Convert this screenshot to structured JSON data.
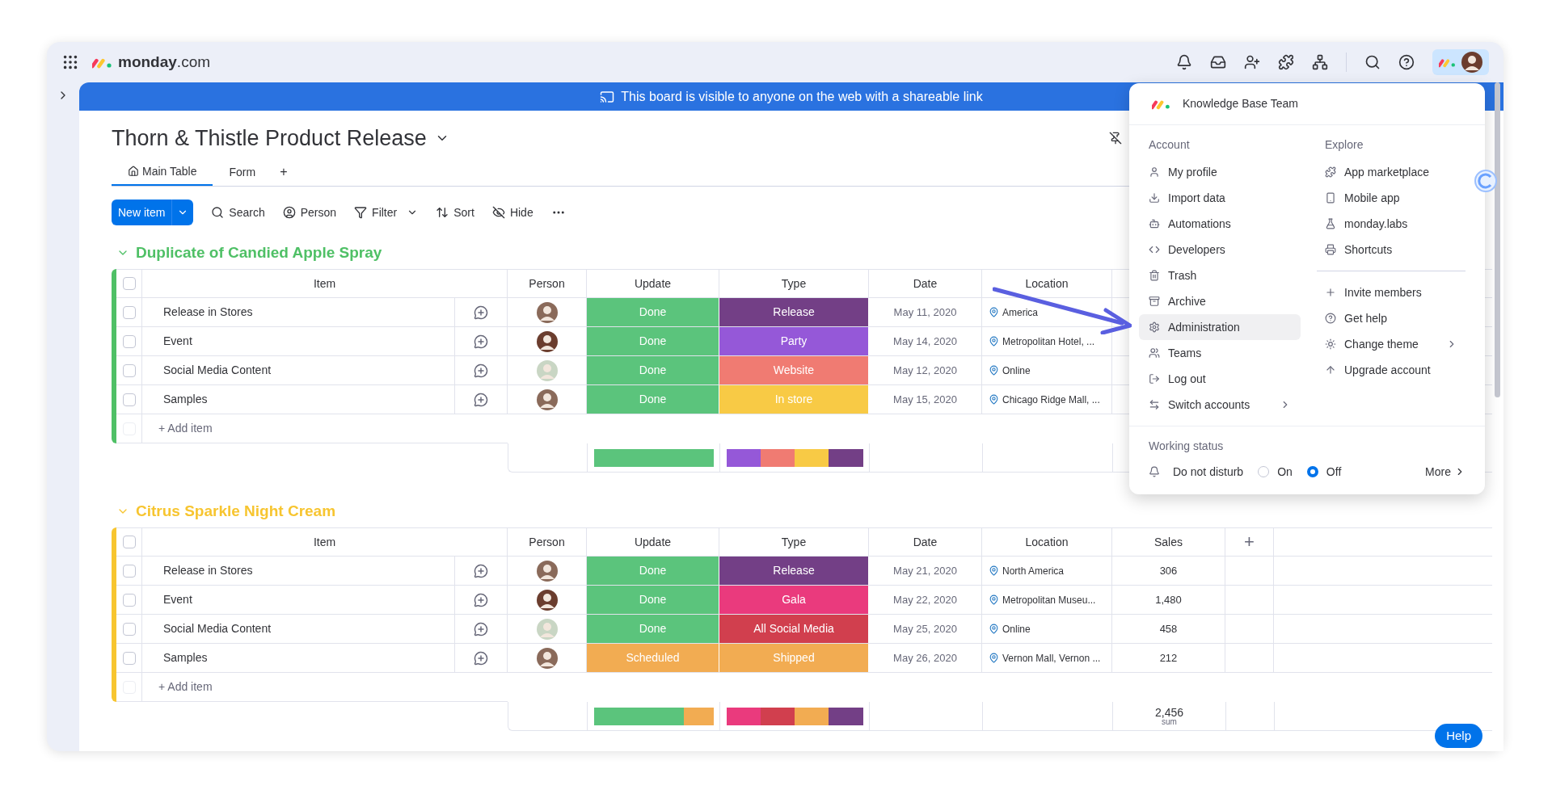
{
  "brand": "**monday**.com",
  "banner": {
    "text": "This board is visible to anyone on the web with a shareable link"
  },
  "board": {
    "title": "Thorn & Thistle Product Release",
    "tabs": [
      {
        "label": "Main Table",
        "selected": true
      },
      {
        "label": "Form",
        "selected": false
      }
    ],
    "add_tab": "+"
  },
  "toolbar": {
    "new_item": "New item",
    "actions": [
      {
        "label": "Search",
        "dropdown": false
      },
      {
        "label": "Person",
        "dropdown": false
      },
      {
        "label": "Filter",
        "dropdown": true
      },
      {
        "label": "Sort",
        "dropdown": false
      },
      {
        "label": "Hide",
        "dropdown": false
      }
    ]
  },
  "groups": [
    {
      "name": "Duplicate of Candied Apple Spray",
      "color": "#4fc066",
      "columns": [
        {
          "label": "Item",
          "kind": "item"
        },
        {
          "label": "Person",
          "kind": "person"
        },
        {
          "label": "Update",
          "kind": "update"
        },
        {
          "label": "Type",
          "kind": "type"
        },
        {
          "label": "Date",
          "kind": "date"
        },
        {
          "label": "Location",
          "kind": "location"
        }
      ],
      "rows": [
        {
          "item": "Release in Stores",
          "checked": false,
          "update": {
            "label": "Done",
            "color": "#5bc47c"
          },
          "type": {
            "label": "Release",
            "color": "#733f86"
          },
          "date": "May 11, 2020",
          "location": "America"
        },
        {
          "item": "Event",
          "checked": false,
          "update": {
            "label": "Done",
            "color": "#5bc47c"
          },
          "type": {
            "label": "Party",
            "color": "#9558d8"
          },
          "date": "May 14, 2020",
          "location": "Metropolitan Hotel, ..."
        },
        {
          "item": "Social Media Content",
          "checked": false,
          "update": {
            "label": "Done",
            "color": "#5bc47c"
          },
          "type": {
            "label": "Website",
            "color": "#f07b72"
          },
          "date": "May 12, 2020",
          "location": "Online"
        },
        {
          "item": "Samples",
          "checked": false,
          "update": {
            "label": "Done",
            "color": "#5bc47c"
          },
          "type": {
            "label": "In store",
            "color": "#f8ca45"
          },
          "date": "May 15, 2020",
          "location": "Chicago Ridge Mall, ..."
        }
      ],
      "add_item": "+ Add item",
      "summary": {
        "update": [
          {
            "color": "#5bc47c"
          },
          {
            "color": "#5bc47c"
          },
          {
            "color": "#5bc47c"
          },
          {
            "color": "#5bc47c"
          }
        ],
        "type": [
          {
            "color": "#9558d8"
          },
          {
            "color": "#f07b72"
          },
          {
            "color": "#f8ca45"
          },
          {
            "color": "#733f86"
          }
        ]
      },
      "all_checked": false,
      "add_item_checkbox_disabled": true
    },
    {
      "name": "Citrus Sparkle Night Cream",
      "color": "#f7c530",
      "add_column": "+",
      "columns": [
        {
          "label": "Item",
          "kind": "item"
        },
        {
          "label": "Person",
          "kind": "person"
        },
        {
          "label": "Update",
          "kind": "update"
        },
        {
          "label": "Type",
          "kind": "type"
        },
        {
          "label": "Date",
          "kind": "date"
        },
        {
          "label": "Location",
          "kind": "location"
        },
        {
          "label": "Sales",
          "kind": "sales"
        }
      ],
      "rows": [
        {
          "item": "Release in Stores",
          "checked": false,
          "update": {
            "label": "Done",
            "color": "#5bc47c"
          },
          "type": {
            "label": "Release",
            "color": "#733f86"
          },
          "date": "May 21, 2020",
          "location": "North America",
          "sales": "306"
        },
        {
          "item": "Event",
          "checked": false,
          "update": {
            "label": "Done",
            "color": "#5bc47c"
          },
          "type": {
            "label": "Gala",
            "color": "#ea3a7d"
          },
          "date": "May 22, 2020",
          "location": "Metropolitan Museu...",
          "sales": "1,480"
        },
        {
          "item": "Social Media Content",
          "checked": false,
          "update": {
            "label": "Done",
            "color": "#5bc47c"
          },
          "type": {
            "label": "All Social Media",
            "color": "#d13f4e"
          },
          "date": "May 25, 2020",
          "location": "Online",
          "sales": "458"
        },
        {
          "item": "Samples",
          "checked": false,
          "update": {
            "label": "Scheduled",
            "color": "#f2ac52"
          },
          "type": {
            "label": "Shipped",
            "color": "#f2ac52"
          },
          "date": "May 26, 2020",
          "location": "Vernon Mall, Vernon ...",
          "sales": "212"
        }
      ],
      "add_item": "+ Add item",
      "summary": {
        "update": [
          {
            "color": "#5bc47c"
          },
          {
            "color": "#5bc47c"
          },
          {
            "color": "#5bc47c"
          },
          {
            "color": "#f2ac52"
          }
        ],
        "type": [
          {
            "color": "#ea3a7d"
          },
          {
            "color": "#d13f4e"
          },
          {
            "color": "#f2ac52"
          },
          {
            "color": "#733f86"
          }
        ],
        "sales": {
          "value": "2,456",
          "label": "sum"
        }
      },
      "all_checked": false,
      "add_item_checkbox_disabled": true
    }
  ],
  "menu": {
    "team": "Knowledge Base Team",
    "account": {
      "heading": "Account",
      "items": [
        {
          "label": "My profile",
          "selected": false,
          "submenu": false
        },
        {
          "label": "Import data",
          "selected": false,
          "submenu": false
        },
        {
          "label": "Automations",
          "selected": false,
          "submenu": false
        },
        {
          "label": "Developers",
          "selected": false,
          "submenu": false
        },
        {
          "label": "Trash",
          "selected": false,
          "submenu": false
        },
        {
          "label": "Archive",
          "selected": false,
          "submenu": false
        },
        {
          "label": "Administration",
          "selected": true,
          "submenu": false
        },
        {
          "label": "Teams",
          "selected": false,
          "submenu": false
        },
        {
          "label": "Log out",
          "selected": false,
          "submenu": false
        },
        {
          "label": "Switch accounts",
          "selected": false,
          "submenu": true
        }
      ]
    },
    "explore": {
      "heading": "Explore",
      "items": [
        {
          "label": "App marketplace",
          "selected": false,
          "submenu": false
        },
        {
          "label": "Mobile app",
          "selected": false,
          "submenu": false
        },
        {
          "label": "monday.labs",
          "selected": false,
          "submenu": false
        },
        {
          "label": "Shortcuts",
          "selected": false,
          "submenu": false
        }
      ],
      "more_items": [
        {
          "label": "Invite members",
          "selected": false,
          "submenu": false
        },
        {
          "label": "Get help",
          "selected": false,
          "submenu": false
        },
        {
          "label": "Change theme",
          "selected": false,
          "submenu": true
        },
        {
          "label": "Upgrade account",
          "selected": false,
          "submenu": false
        }
      ]
    },
    "working_status": {
      "heading": "Working status",
      "label": "Do not disturb",
      "options": [
        {
          "label": "On",
          "selected": false
        },
        {
          "label": "Off",
          "selected": true
        }
      ],
      "more": "More"
    }
  },
  "help": "Help"
}
